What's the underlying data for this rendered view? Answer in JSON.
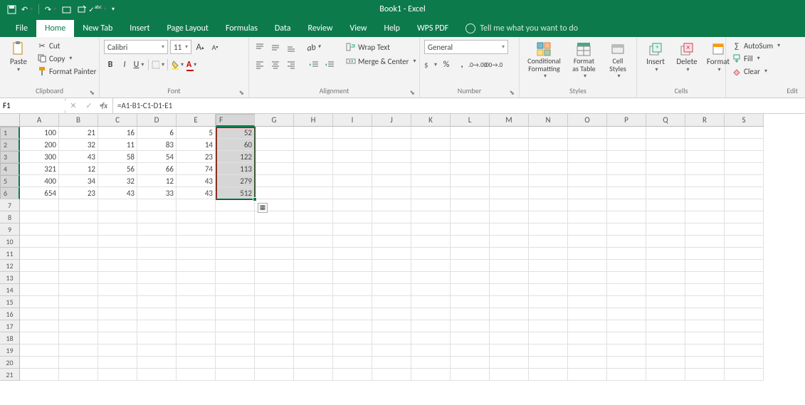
{
  "title": "Book1 - Excel",
  "tabs": [
    "File",
    "Home",
    "New Tab",
    "Insert",
    "Page Layout",
    "Formulas",
    "Data",
    "Review",
    "View",
    "Help",
    "WPS PDF"
  ],
  "active_tab": "Home",
  "tellme": "Tell me what you want to do",
  "clipboard": {
    "cut": "Cut",
    "copy": "Copy",
    "fmtpaint": "Format Painter",
    "paste": "Paste",
    "label": "Clipboard"
  },
  "font": {
    "name": "Calibri",
    "size": "11",
    "label": "Font"
  },
  "alignment": {
    "wrap": "Wrap Text",
    "merge": "Merge & Center",
    "label": "Alignment"
  },
  "number": {
    "format": "General",
    "label": "Number"
  },
  "styles": {
    "cond": "Conditional Formatting",
    "fmt": "Format as Table",
    "cell": "Cell Styles",
    "label": "Styles"
  },
  "cells": {
    "insert": "Insert",
    "delete": "Delete",
    "format": "Format",
    "label": "Cells"
  },
  "editing": {
    "autosum": "AutoSum",
    "fill": "Fill",
    "clear": "Clear",
    "label": "Edit"
  },
  "namebox": "F1",
  "formula": "=A1-B1-C1-D1-E1",
  "columns": [
    "A",
    "B",
    "C",
    "D",
    "E",
    "F",
    "G",
    "H",
    "I",
    "J",
    "K",
    "L",
    "M",
    "N",
    "O",
    "P",
    "Q",
    "R",
    "S"
  ],
  "row_count": 21,
  "data_rows": [
    {
      "A": "100",
      "B": "21",
      "C": "16",
      "D": "6",
      "E": "5",
      "F": "52"
    },
    {
      "A": "200",
      "B": "32",
      "C": "11",
      "D": "83",
      "E": "14",
      "F": "60"
    },
    {
      "A": "300",
      "B": "43",
      "C": "58",
      "D": "54",
      "E": "23",
      "F": "122"
    },
    {
      "A": "321",
      "B": "12",
      "C": "56",
      "D": "66",
      "E": "74",
      "F": "113"
    },
    {
      "A": "400",
      "B": "34",
      "C": "32",
      "D": "12",
      "E": "43",
      "F": "279"
    },
    {
      "A": "654",
      "B": "23",
      "C": "43",
      "D": "33",
      "E": "43",
      "F": "512"
    }
  ],
  "selection": {
    "col": "F",
    "rows": [
      1,
      6
    ]
  },
  "chart_data": null
}
